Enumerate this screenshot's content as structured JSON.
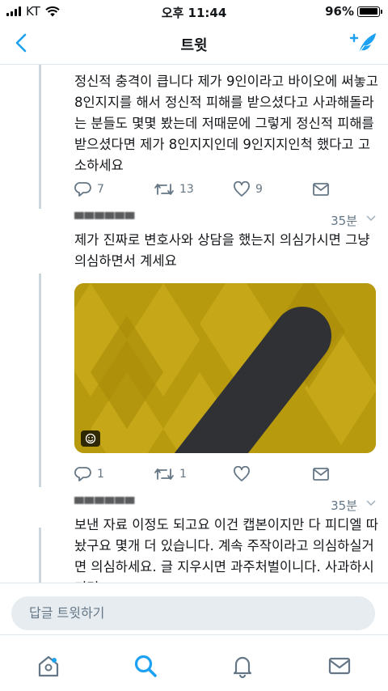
{
  "status_bar": {
    "carrier": "KT",
    "time": "오후 11:44",
    "battery_percent": "96%",
    "battery_level": 0.96,
    "signal_icon": "signal-bars-icon",
    "wifi_icon": "wifi-icon"
  },
  "nav": {
    "title": "트윗",
    "back_icon": "chevron-left-icon",
    "compose_icon": "compose-tweet-icon"
  },
  "tweets": [
    {
      "text": "정신적 충격이 큽니다 제가 9인이라고 바이오에 써놓고 8인지지를 해서 정신적 피해를 받으셨다고 사과해돌라는 분들도 몇몇 봤는데 저때문에 그렇게 정신적 피해를 받으셨다면 제가 8인지지인데 9인지지인척 했다고 고소하세요",
      "replies": "7",
      "retweets": "13",
      "likes": "9"
    },
    {
      "time": "35분",
      "text": "제가 진짜로 변호사와 상담을 했는지 의심가시면 그냥 의심하면서 계세요",
      "replies": "1",
      "retweets": "1",
      "likes": "",
      "media_badge": "gif-badge-icon"
    },
    {
      "time": "35분",
      "text": "보낸 자료 이정도 되고요 이건 캡본이지만 다 피디엘 따놨구요 몇개 더 있습니다. 계속 주작이라고 의심하실거면 의심하세요. 글 지우시면 과주처벌이니다. 사과하시기면"
    }
  ],
  "reply_bar": {
    "placeholder": "답글 트윗하기"
  },
  "tabbar": {
    "items": [
      "home-icon",
      "search-icon",
      "notifications-icon",
      "messages-icon"
    ],
    "active": "search-icon"
  },
  "colors": {
    "accent": "#1da1f2",
    "muted": "#657786",
    "divider": "#e1e8ed",
    "thread_line": "#ccd6dd",
    "media_background": "#b8980c",
    "media_stroke": "#2f3134"
  }
}
